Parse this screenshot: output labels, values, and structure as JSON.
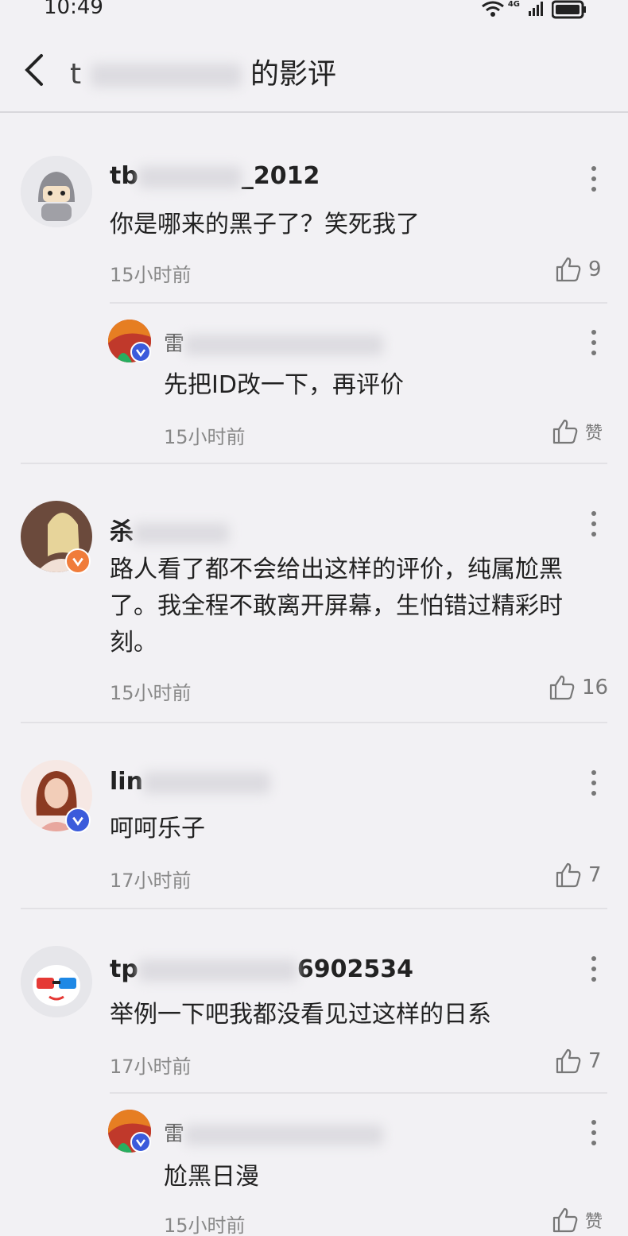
{
  "status_bar": {
    "time": "10:49",
    "network": "4G"
  },
  "header": {
    "title_visible": "的影评",
    "title_prefix": "t"
  },
  "comments": [
    {
      "username": "_2012",
      "username_prefix": "tb",
      "text": "你是哪来的黑子了？笑死我了",
      "time": "15小时前",
      "likes": "9"
    },
    {
      "reply": true,
      "username": "雷",
      "text": "先把ID改一下，再评价",
      "time": "15小时前",
      "likes": "赞"
    },
    {
      "username": "杀",
      "text": "路人看了都不会给出这样的评价，纯属尬黑了。我全程不敢离开屏幕，生怕错过精彩时刻。",
      "time": "15小时前",
      "likes": "16"
    },
    {
      "username": "lin",
      "text": "呵呵乐子",
      "time": "17小时前",
      "likes": "7"
    },
    {
      "username": "6902534",
      "username_prefix": "tp",
      "text": "举例一下吧我都没看见过这样的日系",
      "time": "17小时前",
      "likes": "7"
    },
    {
      "reply": true,
      "username": "雷",
      "text": "尬黑日漫",
      "time": "15小时前",
      "likes": "赞"
    }
  ],
  "colors": {
    "background": "#f2f1f4",
    "text": "#222222",
    "muted": "#888888",
    "badge_blue": "#3b5bdb",
    "badge_orange": "#f07c3a"
  }
}
